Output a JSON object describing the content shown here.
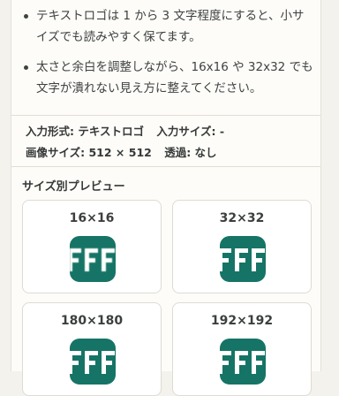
{
  "tips": [
    "テキストロゴは 1 から 3 文字程度にすると、小サイズでも読みやすく保てます。",
    "太さと余白を調整しながら、16x16 や 32x32 でも文字が潰れない見え方に整えてください。"
  ],
  "meta": {
    "input_format": "入力形式: テキストロゴ",
    "input_size": "入力サイズ: -",
    "image_size": "画像サイズ: 512 × 512",
    "transparency": "透過: なし"
  },
  "preview": {
    "heading": "サイズ別プレビュー",
    "items": [
      {
        "label": "16×16",
        "icon": "fff-logo-icon"
      },
      {
        "label": "32×32",
        "icon": "fff-logo-icon"
      },
      {
        "label": "180×180",
        "icon": "fff-logo-icon"
      },
      {
        "label": "192×192",
        "icon": "fff-logo-icon"
      }
    ]
  },
  "colors": {
    "icon_background": "#167466",
    "icon_text": "#ffffff"
  }
}
